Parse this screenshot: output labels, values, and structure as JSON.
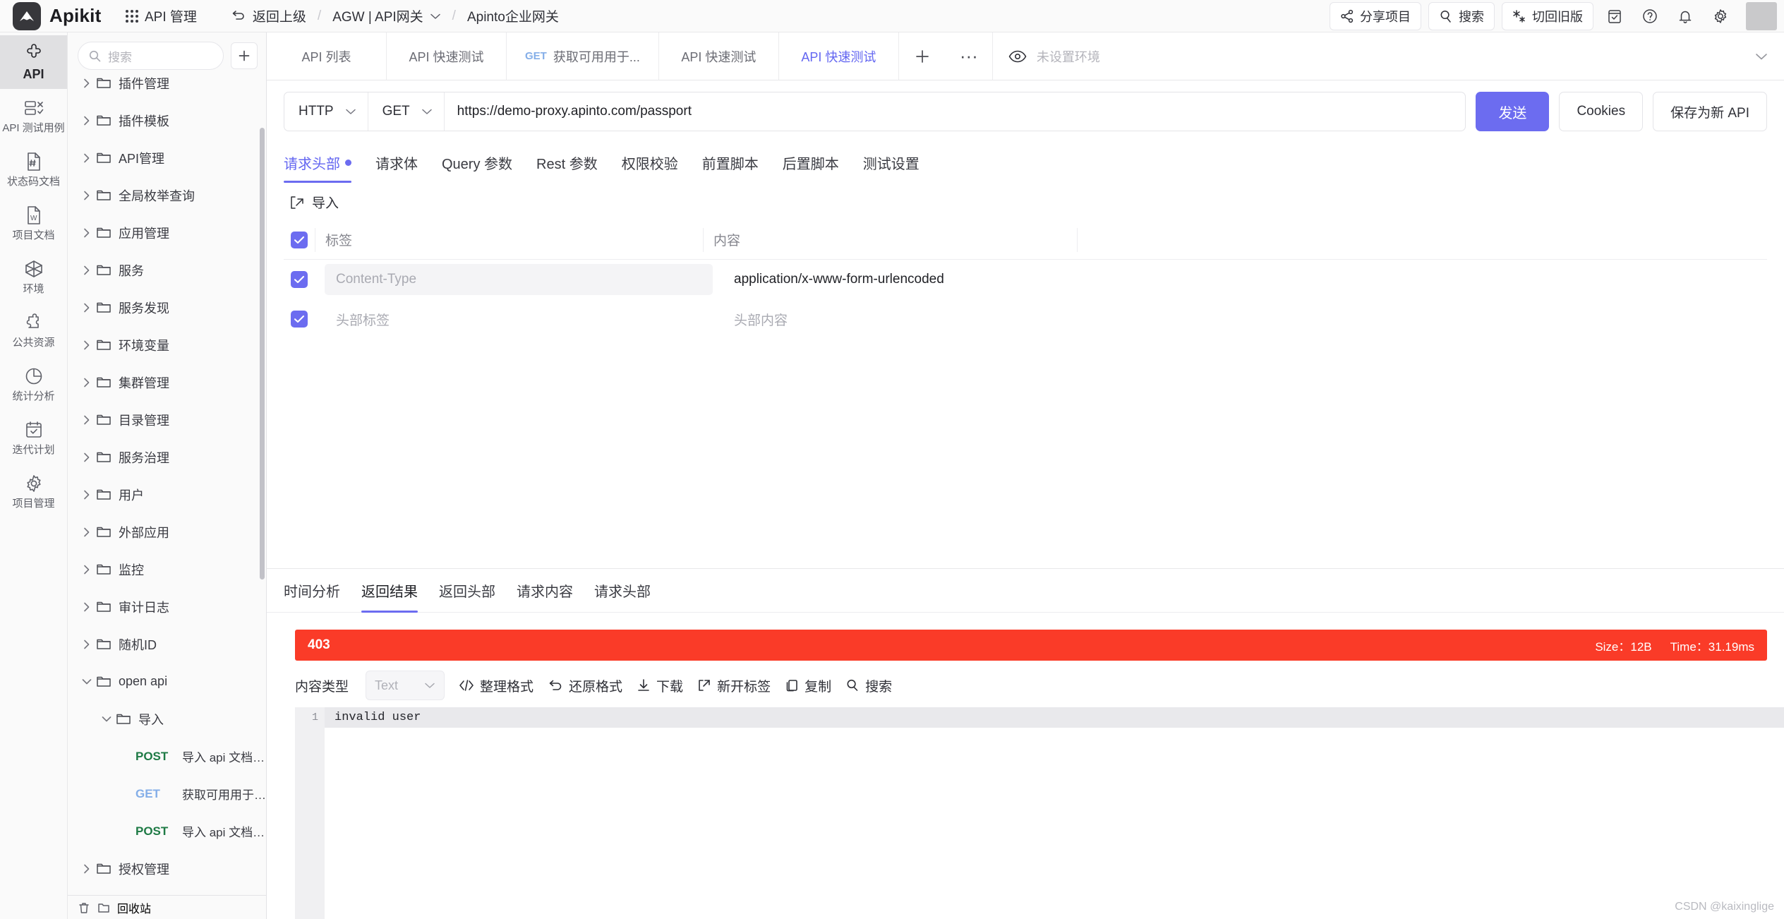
{
  "header": {
    "brand": "Apikit",
    "nav_module": "API 管理",
    "back": "返回上级",
    "breadcrumb_project": "AGW | API网关",
    "breadcrumb_sep": "/",
    "breadcrumb_current": "Apinto企业网关",
    "share": "分享项目",
    "search": "搜索",
    "switch_old": "切回旧版"
  },
  "rail": {
    "items": [
      {
        "label": "API",
        "icon": "api-icon",
        "active": true
      },
      {
        "label": "API 测试用例",
        "icon": "testcase-icon",
        "active": false
      },
      {
        "label": "状态码文档",
        "icon": "statuscode-icon",
        "active": false
      },
      {
        "label": "项目文档",
        "icon": "document-icon",
        "active": false
      },
      {
        "label": "环境",
        "icon": "environment-icon",
        "active": false
      },
      {
        "label": "公共资源",
        "icon": "puzzle-icon",
        "active": false
      },
      {
        "label": "统计分析",
        "icon": "chart-icon",
        "active": false
      },
      {
        "label": "迭代计划",
        "icon": "calendar-icon",
        "active": false
      },
      {
        "label": "项目管理",
        "icon": "gear-icon",
        "active": false
      }
    ]
  },
  "tree": {
    "search_placeholder": "搜索",
    "add_label": "+",
    "nodes": [
      {
        "level": 1,
        "label": "插件管理",
        "expanded": false,
        "type": "folder"
      },
      {
        "level": 1,
        "label": "插件模板",
        "expanded": false,
        "type": "folder"
      },
      {
        "level": 1,
        "label": "API管理",
        "expanded": false,
        "type": "folder"
      },
      {
        "level": 1,
        "label": "全局枚举查询",
        "expanded": false,
        "type": "folder"
      },
      {
        "level": 1,
        "label": "应用管理",
        "expanded": false,
        "type": "folder"
      },
      {
        "level": 1,
        "label": "服务",
        "expanded": false,
        "type": "folder"
      },
      {
        "level": 1,
        "label": "服务发现",
        "expanded": false,
        "type": "folder"
      },
      {
        "level": 1,
        "label": "环境变量",
        "expanded": false,
        "type": "folder"
      },
      {
        "level": 1,
        "label": "集群管理",
        "expanded": false,
        "type": "folder"
      },
      {
        "level": 1,
        "label": "目录管理",
        "expanded": false,
        "type": "folder"
      },
      {
        "level": 1,
        "label": "服务治理",
        "expanded": false,
        "type": "folder"
      },
      {
        "level": 1,
        "label": "用户",
        "expanded": false,
        "type": "folder"
      },
      {
        "level": 1,
        "label": "外部应用",
        "expanded": false,
        "type": "folder"
      },
      {
        "level": 1,
        "label": "监控",
        "expanded": false,
        "type": "folder"
      },
      {
        "level": 1,
        "label": "审计日志",
        "expanded": false,
        "type": "folder"
      },
      {
        "level": 1,
        "label": "随机ID",
        "expanded": false,
        "type": "folder"
      },
      {
        "level": 1,
        "label": "open api",
        "expanded": true,
        "type": "folder"
      },
      {
        "level": 2,
        "label": "导入",
        "expanded": true,
        "type": "folder"
      },
      {
        "level": 3,
        "method": "POST",
        "label": "导入 api 文档, f...",
        "type": "endpoint"
      },
      {
        "level": 3,
        "method": "GET",
        "label": "获取可用用于导...",
        "type": "endpoint"
      },
      {
        "level": 3,
        "method": "POST",
        "label": "导入 api 文档, js...",
        "type": "endpoint"
      },
      {
        "level": 1,
        "label": "授权管理",
        "expanded": false,
        "type": "folder"
      }
    ],
    "bottom_label": "回收站"
  },
  "tabbar": {
    "tabs": [
      {
        "label": "API 列表",
        "method": "",
        "active": false
      },
      {
        "label": "API 快速测试",
        "method": "",
        "active": false
      },
      {
        "label": "获取可用用于...",
        "method": "GET",
        "active": false
      },
      {
        "label": "API 快速测试",
        "method": "",
        "active": false
      },
      {
        "label": "API 快速测试",
        "method": "",
        "active": true
      }
    ],
    "add": "+",
    "more": "···",
    "environment": "未设置环境"
  },
  "request": {
    "protocol": "HTTP",
    "method": "GET",
    "url": "https://demo-proxy.apinto.com/passport",
    "send_label": "发送",
    "cookies_label": "Cookies",
    "save_label": "保存为新 API",
    "tabs": [
      {
        "label": "请求头部",
        "active": true,
        "dot": true
      },
      {
        "label": "请求体",
        "active": false,
        "dot": false
      },
      {
        "label": "Query 参数",
        "active": false,
        "dot": false
      },
      {
        "label": "Rest 参数",
        "active": false,
        "dot": false
      },
      {
        "label": "权限校验",
        "active": false,
        "dot": false
      },
      {
        "label": "前置脚本",
        "active": false,
        "dot": false
      },
      {
        "label": "后置脚本",
        "active": false,
        "dot": false
      },
      {
        "label": "测试设置",
        "active": false,
        "dot": false
      }
    ],
    "import_label": "导入",
    "headers_table": {
      "columns": [
        "标签",
        "内容"
      ],
      "rows": [
        {
          "checked": true,
          "key": "Content-Type",
          "key_is_placeholder": true,
          "value": "application/x-www-form-urlencoded",
          "value_is_placeholder": false
        },
        {
          "checked": true,
          "key": "头部标签",
          "key_is_placeholder": true,
          "value": "头部内容",
          "value_is_placeholder": true
        }
      ]
    }
  },
  "response": {
    "tabs": [
      {
        "label": "时间分析",
        "active": false
      },
      {
        "label": "返回结果",
        "active": true
      },
      {
        "label": "返回头部",
        "active": false
      },
      {
        "label": "请求内容",
        "active": false
      },
      {
        "label": "请求头部",
        "active": false
      }
    ],
    "status_code": "403",
    "size_label": "Size：12B",
    "time_label": "Time：31.19ms",
    "content_type_label": "内容类型",
    "content_type_value": "Text",
    "toolbar": [
      {
        "label": "整理格式",
        "icon": "code-icon"
      },
      {
        "label": "还原格式",
        "icon": "undo-icon"
      },
      {
        "label": "下载",
        "icon": "download-icon"
      },
      {
        "label": "新开标签",
        "icon": "external-link-icon"
      },
      {
        "label": "复制",
        "icon": "copy-icon"
      },
      {
        "label": "搜索",
        "icon": "search-icon"
      }
    ],
    "body_line_number": "1",
    "body_text": "invalid user"
  },
  "watermark": "CSDN @kaixinglige"
}
